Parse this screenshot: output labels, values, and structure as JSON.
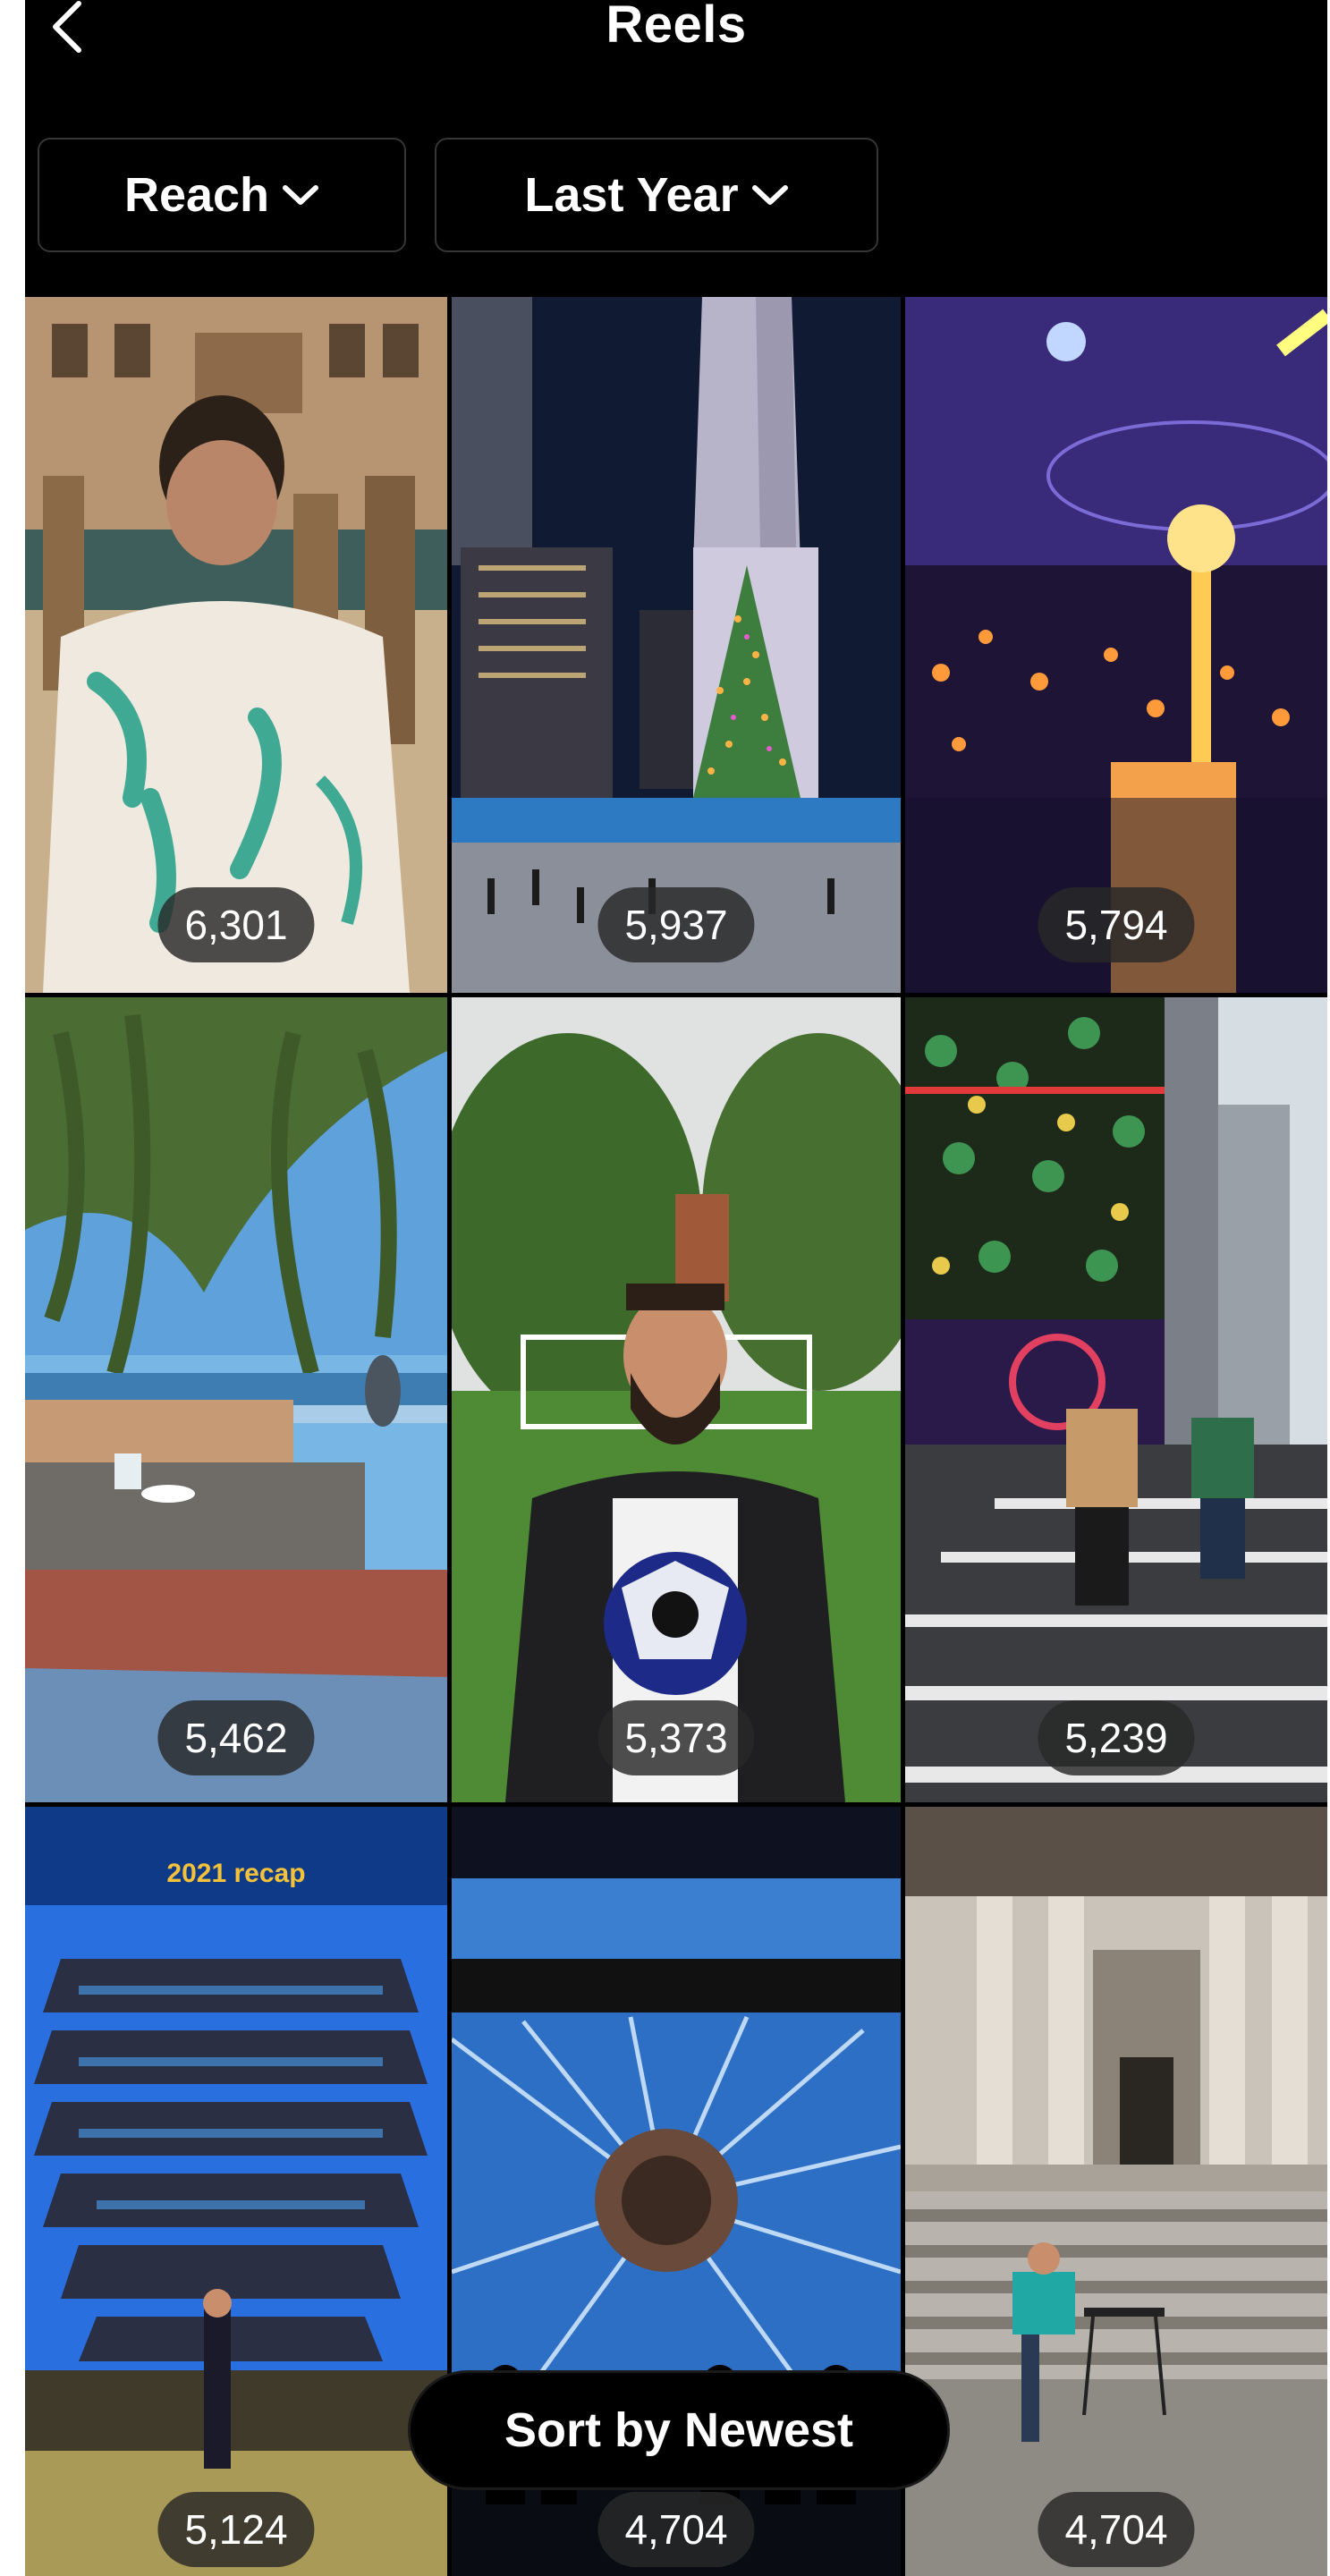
{
  "header": {
    "title": "Reels",
    "back_icon": "chevron-left-icon"
  },
  "filters": {
    "metric_label": "Reach",
    "period_label": "Last Year",
    "dropdown_icon": "chevron-down-icon"
  },
  "reels": [
    {
      "count": "6,301",
      "scene": "man-venice-canal"
    },
    {
      "count": "5,937",
      "scene": "rockefeller-christmas-tree"
    },
    {
      "count": "5,794",
      "scene": "party-sparklers"
    },
    {
      "count": "5,462",
      "scene": "palm-cafe-seaside"
    },
    {
      "count": "5,373",
      "scene": "man-with-soccer-ball"
    },
    {
      "count": "5,239",
      "scene": "city-crosswalk"
    },
    {
      "count": "5,124",
      "scene": "vessel-structure",
      "caption": "2021 recap"
    },
    {
      "count": "4,704",
      "scene": "immersive-art-tunnel"
    },
    {
      "count": "4,704",
      "scene": "library-steps"
    }
  ],
  "sort_button": {
    "label": "Sort by Newest"
  }
}
